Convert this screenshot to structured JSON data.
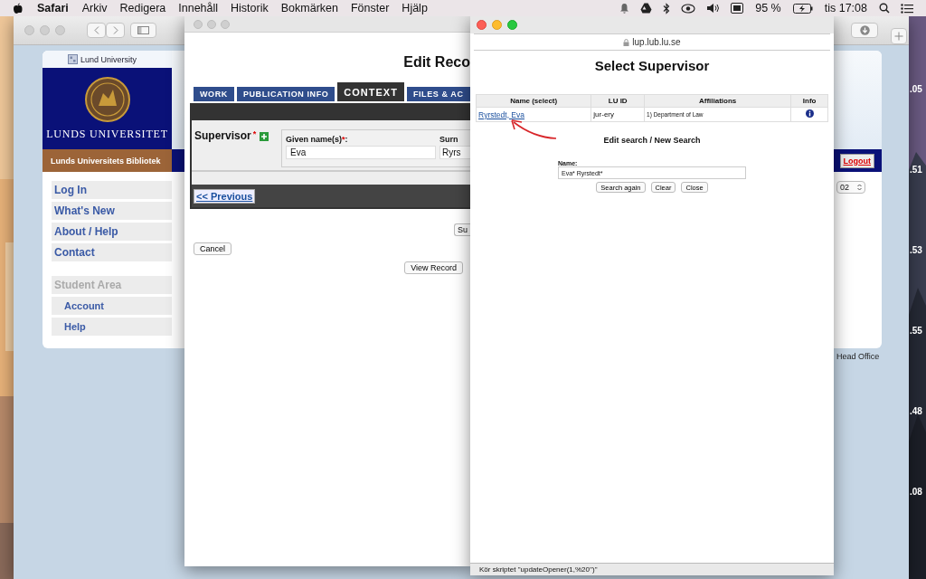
{
  "menu_bar": {
    "app": "Safari",
    "menus": [
      "Arkiv",
      "Redigera",
      "Innehåll",
      "Historik",
      "Bokmärken",
      "Fönster",
      "Hjälp"
    ],
    "battery": "95 %",
    "clock": "tis 17:08"
  },
  "back_window": {
    "university_label": "Lund University",
    "university_name": "LUNDS UNIVERSITET",
    "library": "Lunds Universitets Bibliotek",
    "nav": [
      {
        "label": "Log In",
        "kind": "link"
      },
      {
        "label": "What's New",
        "kind": "link"
      },
      {
        "label": "About / Help",
        "kind": "link"
      },
      {
        "label": "Contact",
        "kind": "link"
      },
      {
        "label": "Student Area",
        "kind": "heading"
      },
      {
        "label": "Account",
        "kind": "sub"
      },
      {
        "label": "Help",
        "kind": "sub"
      }
    ],
    "logout": "Logout",
    "select_value": "02",
    "footer_fragment": "Head Office"
  },
  "desktop_fragments": [
    ".05",
    ".51",
    ".53",
    ".55",
    ".48",
    ".08"
  ],
  "edit_window": {
    "title": "Edit Reco",
    "tabs": [
      {
        "label": "WORK",
        "selected": false
      },
      {
        "label": "PUBLICATION INFO",
        "selected": false
      },
      {
        "label": "CONTEXT",
        "selected": true
      },
      {
        "label": "FILES & AC",
        "selected": false
      }
    ],
    "supervisor_label": "Supervisor",
    "required_mark": "*",
    "given_label": "Given name(s)",
    "given_required": "*",
    "given_suffix": ":",
    "given_value": "Eva",
    "surname_label": "Surn",
    "surname_value": "Ryrs",
    "previous": "<< Previous",
    "submit_fragment": "Su",
    "cancel": "Cancel",
    "view_record": "View Record"
  },
  "popup": {
    "url": "lup.lub.lu.se",
    "title": "Select Supervisor",
    "table": {
      "columns": [
        "Name (select)",
        "LU ID",
        "Affiliations",
        "Info"
      ],
      "rows": [
        {
          "name": "Ryrstedt, Eva",
          "lu_id": "jur-ery",
          "affiliations": "1) Department of Law"
        }
      ]
    },
    "search_heading": "Edit search / New Search",
    "name_label": "Name:",
    "name_value": "Eva* Ryrstedt*",
    "buttons": [
      "Search again",
      "Clear",
      "Close"
    ],
    "status": "Kör skriptet \"updateOpener(1,%20'')\""
  }
}
